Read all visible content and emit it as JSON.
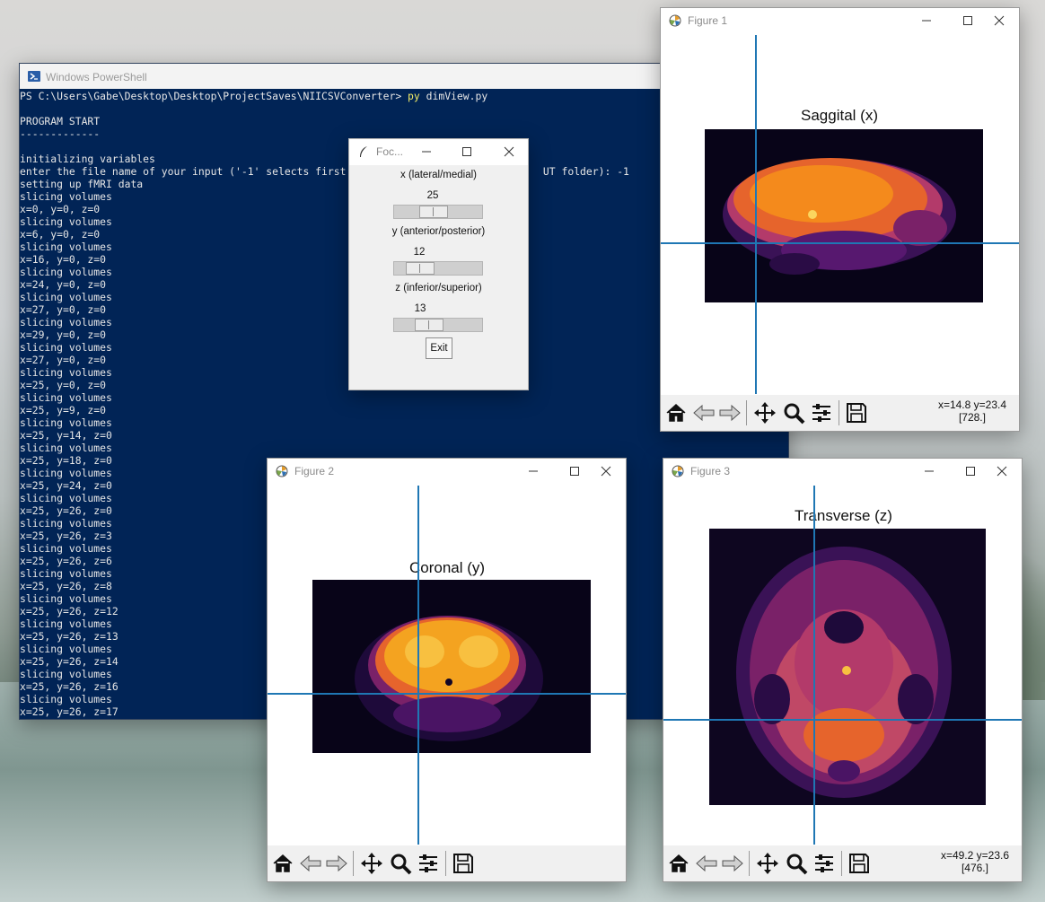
{
  "desktop": {},
  "powershell": {
    "title": "Windows PowerShell",
    "prompt": "PS C:\\Users\\Gabe\\Desktop\\Desktop\\ProjectSaves\\NIICSVConverter> ",
    "command_py": "py",
    "command_rest": " dimView.py",
    "lines": [
      "",
      "PROGRAM START",
      "-------------",
      "",
      "initializing variables",
      "enter the file name of your input ('-1' selects first                                UT folder): -1",
      "setting up fMRI data",
      "slicing volumes",
      "x=0, y=0, z=0",
      "slicing volumes",
      "x=6, y=0, z=0",
      "slicing volumes",
      "x=16, y=0, z=0",
      "slicing volumes",
      "x=24, y=0, z=0",
      "slicing volumes",
      "x=27, y=0, z=0",
      "slicing volumes",
      "x=29, y=0, z=0",
      "slicing volumes",
      "x=27, y=0, z=0",
      "slicing volumes",
      "x=25, y=0, z=0",
      "slicing volumes",
      "x=25, y=9, z=0",
      "slicing volumes",
      "x=25, y=14, z=0",
      "slicing volumes",
      "x=25, y=18, z=0",
      "slicing volumes",
      "x=25, y=24, z=0",
      "slicing volumes",
      "x=25, y=26, z=0",
      "slicing volumes",
      "x=25, y=26, z=3",
      "slicing volumes",
      "x=25, y=26, z=6",
      "slicing volumes",
      "x=25, y=26, z=8",
      "slicing volumes",
      "x=25, y=26, z=12",
      "slicing volumes",
      "x=25, y=26, z=13",
      "slicing volumes",
      "x=25, y=26, z=14",
      "slicing volumes",
      "x=25, y=26, z=16",
      "slicing volumes",
      "x=25, y=26, z=17"
    ]
  },
  "focus_dialog": {
    "title": "Foc...",
    "x_label": "x (lateral/medial)",
    "x_value": "25",
    "y_label": "y (anterior/posterior)",
    "y_value": "12",
    "z_label": "z (inferior/superior)",
    "z_value": "13",
    "exit_label": "Exit"
  },
  "figures": {
    "figure1": {
      "title": "Figure 1",
      "plot_title": "Saggital (x)",
      "coord_line1": "x=14.8 y=23.4",
      "coord_line2": "[728.]"
    },
    "figure2": {
      "title": "Figure 2",
      "plot_title": "Coronal (y)"
    },
    "figure3": {
      "title": "Figure 3",
      "plot_title": "Transverse (z)",
      "coord_line1": "x=49.2 y=23.6",
      "coord_line2": "[476.]"
    }
  },
  "colors": {
    "crosshair": "#1f77b4",
    "terminal_bg": "#012456",
    "command_highlight": "#f2ec66"
  }
}
